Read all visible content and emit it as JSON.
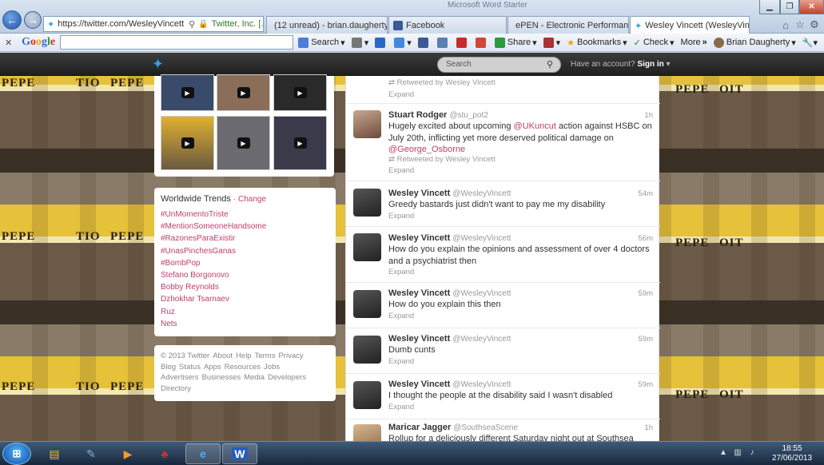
{
  "browser": {
    "url": "https://twitter.com/WesleyVincett",
    "cert": "Twitter, Inc. [...",
    "window_title": "Microsoft Word Starter",
    "tabs": [
      {
        "label": "(12 unread) - brian.daugherty..."
      },
      {
        "label": "Facebook"
      },
      {
        "label": "ePEN - Electronic Performance..."
      },
      {
        "label": "Wesley Vincett (WesleyVinc..."
      }
    ]
  },
  "toolbar": {
    "google": {
      "g1": "G",
      "o1": "o",
      "o2": "o",
      "g2": "g",
      "l": "l",
      "e": "e"
    },
    "search_label": "Search",
    "share_label": "Share",
    "bookmarks_label": "Bookmarks",
    "check_label": "Check",
    "more_label": "More",
    "more_arrows": "»",
    "user_label": "Brian Daugherty"
  },
  "twitter": {
    "search_placeholder": "Search",
    "account_prompt": "Have an account?",
    "signin": "Sign in",
    "trends": {
      "title": "Worldwide Trends",
      "change": "· Change",
      "items": [
        "#UnMomentoTriste",
        "#MentionSomeoneHandsome",
        "#RazonesParaExistir",
        "#UnasPinchesGanas",
        "#BombPop",
        "Stefano Borgonovo",
        "Bobby Reynolds",
        "Dzhokhar Tsarnaev",
        "Ruz",
        "Nets"
      ]
    },
    "footer": [
      "© 2013 Twitter",
      "About",
      "Help",
      "Terms",
      "Privacy",
      "Blog",
      "Status",
      "Apps",
      "Resources",
      "Jobs",
      "Advertisers",
      "Businesses",
      "Media",
      "Developers",
      "Directory"
    ],
    "tweets": [
      {
        "retweet": "Retweeted by Wesley Vincett",
        "expand": "Expand"
      },
      {
        "name": "Stuart Rodger",
        "handle": "@stu_pot2",
        "time": "1h",
        "text_parts": [
          "Hugely excited about upcoming ",
          "@UKuncut",
          " action against HSBC on July 20th, inflicting yet more deserved political damage on ",
          "@George_Osborne"
        ],
        "retweet": "Retweeted by Wesley Vincett",
        "expand": "Expand"
      },
      {
        "name": "Wesley Vincett",
        "handle": "@WesleyVincett",
        "time": "54m",
        "text": "Greedy bastards just didn't want to pay me my disability",
        "expand": "Expand"
      },
      {
        "name": "Wesley Vincett",
        "handle": "@WesleyVincett",
        "time": "56m",
        "text": "How do you explain the opinions and assessment of  over 4 doctors and a psychiatrist then",
        "expand": "Expand"
      },
      {
        "name": "Wesley Vincett",
        "handle": "@WesleyVincett",
        "time": "59m",
        "text": "How do you explain this then",
        "expand": "Expand"
      },
      {
        "name": "Wesley Vincett",
        "handle": "@WesleyVincett",
        "time": "59m",
        "text": "Dumb cunts",
        "expand": "Expand"
      },
      {
        "name": "Wesley Vincett",
        "handle": "@WesleyVincett",
        "time": "59m",
        "text": "I thought the people at the disability said I wasn't disabled",
        "expand": "Expand"
      },
      {
        "name": "Maricar Jagger",
        "handle": "@SouthseaScene",
        "time": "1h",
        "text": "Rollup for a deliciously different Saturday night out at Southsea"
      }
    ],
    "background_sign": {
      "a": "PEPE",
      "b": "TIO",
      "c": "PEPE",
      "d": "OIT"
    }
  },
  "taskbar": {
    "time": "18:55",
    "date": "27/06/2013"
  },
  "colors": {
    "twitter_blue": "#2fa0e3",
    "trend_pink": "#c33d6b",
    "topbar": "#2a2a2a"
  }
}
